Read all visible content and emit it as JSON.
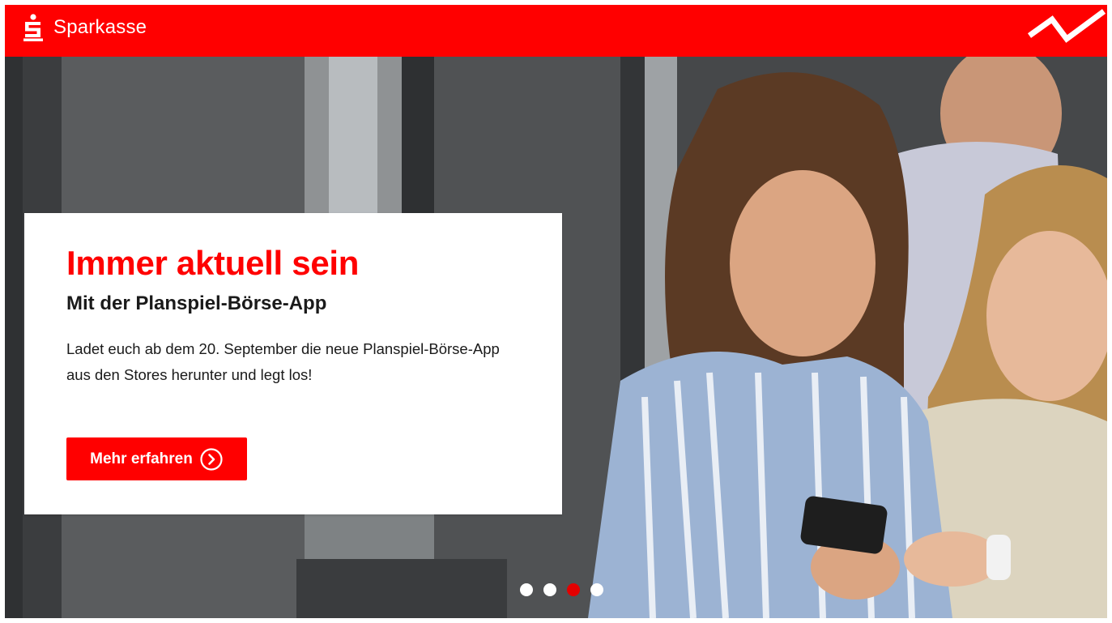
{
  "header": {
    "brand_name": "Sparkasse",
    "brand_color": "#ff0000",
    "logo_icon": "sparkasse-s-icon",
    "corner_icon": "wave-line-icon"
  },
  "hero": {
    "image_icon": "hero-photo-three-young-people-with-smartphone",
    "card": {
      "title": "Immer aktuell sein",
      "subtitle": "Mit der Planspiel-Börse-App",
      "text": "Ladet euch ab dem 20. September die neue Planspiel-Börse-App aus den Stores herunter und legt los!",
      "button_label": "Mehr erfahren",
      "button_icon": "chevron-right-circle-icon"
    },
    "carousel": {
      "slide_count": 4,
      "active_index": 2,
      "dot_color": "#ffffff",
      "active_dot_color": "#e30000"
    }
  }
}
